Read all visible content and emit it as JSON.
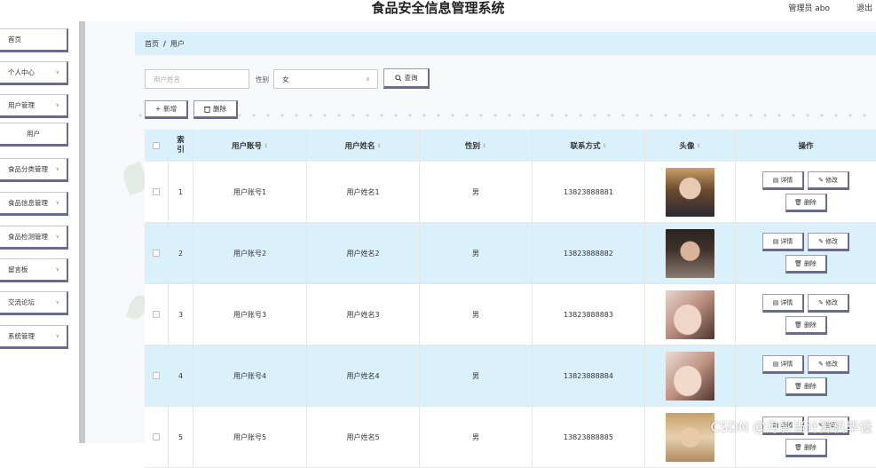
{
  "header": {
    "title": "食品安全信息管理系统",
    "user": "管理员 abo",
    "logout": "退出"
  },
  "sidebar": {
    "items": [
      {
        "label": "首页",
        "has_chevron": false
      },
      {
        "label": "个人中心",
        "has_chevron": true
      },
      {
        "label": "用户管理",
        "has_chevron": true
      },
      {
        "label": "用户",
        "sub": true
      },
      {
        "label": "食品分类管理",
        "has_chevron": true
      },
      {
        "label": "食品信息管理",
        "has_chevron": true
      },
      {
        "label": "食品检测管理",
        "has_chevron": true
      },
      {
        "label": "留言板",
        "has_chevron": true
      },
      {
        "label": "交流论坛",
        "has_chevron": true
      },
      {
        "label": "系统管理",
        "has_chevron": true
      }
    ]
  },
  "breadcrumb": {
    "home": "首页",
    "separator": "/",
    "current": "用户"
  },
  "search": {
    "placeholder": "用户姓名",
    "gender_label": "性别",
    "gender_value": "女",
    "search_label": "查询"
  },
  "toolbar": {
    "add_label": "新增",
    "delete_label": "删除"
  },
  "table": {
    "headers": {
      "index": "索引",
      "account": "用户账号",
      "name": "用户姓名",
      "gender": "性别",
      "phone": "联系方式",
      "avatar": "头像",
      "ops": "操作"
    },
    "ops_labels": {
      "detail": "详情",
      "edit": "修改",
      "delete": "删除"
    },
    "rows": [
      {
        "index": "1",
        "account": "用户账号1",
        "name": "用户姓名1",
        "gender": "男",
        "phone": "13823888881"
      },
      {
        "index": "2",
        "account": "用户账号2",
        "name": "用户姓名2",
        "gender": "男",
        "phone": "13823888882"
      },
      {
        "index": "3",
        "account": "用户账号3",
        "name": "用户姓名3",
        "gender": "男",
        "phone": "13823888883"
      },
      {
        "index": "4",
        "account": "用户账号4",
        "name": "用户姓名4",
        "gender": "男",
        "phone": "13823888884"
      },
      {
        "index": "5",
        "account": "用户账号5",
        "name": "用户姓名5",
        "gender": "男",
        "phone": "13823888885"
      }
    ]
  },
  "watermark": "CSDN @月影当计算机毕设",
  "colors": {
    "accent_bg": "#daf0fb",
    "button_border": "#6b6b8a"
  }
}
